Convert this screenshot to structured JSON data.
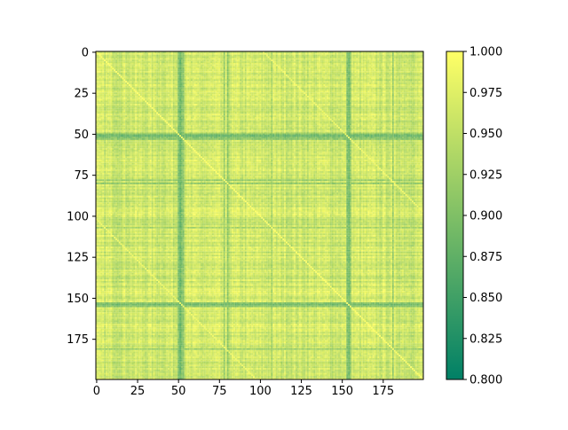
{
  "chart_data": {
    "type": "heatmap",
    "title": "",
    "xlabel": "",
    "ylabel": "",
    "n_rows": 200,
    "n_cols": 200,
    "xlim": [
      0,
      199
    ],
    "ylim": [
      199,
      0
    ],
    "y_axis_inverted": true,
    "x_ticks": [
      0,
      25,
      50,
      75,
      100,
      125,
      150,
      175
    ],
    "x_tick_labels": [
      "0",
      "25",
      "50",
      "75",
      "100",
      "125",
      "150",
      "175"
    ],
    "y_ticks": [
      0,
      25,
      50,
      75,
      100,
      125,
      150,
      175
    ],
    "y_tick_labels": [
      "0",
      "25",
      "50",
      "75",
      "100",
      "125",
      "150",
      "175"
    ],
    "value_range": [
      0.8,
      1.0
    ],
    "typical_value": 0.96,
    "diagonal_value": 1.0,
    "off_diagonal_bands": [
      {
        "offset": 102,
        "value": 0.99
      },
      {
        "offset": -102,
        "value": 0.99
      }
    ],
    "low_similarity_indices": [
      {
        "index": 50,
        "value": 0.9
      },
      {
        "index": 51,
        "value": 0.88
      },
      {
        "index": 52,
        "value": 0.9
      },
      {
        "index": 53,
        "value": 0.91
      },
      {
        "index": 153,
        "value": 0.9
      },
      {
        "index": 154,
        "value": 0.89
      },
      {
        "index": 155,
        "value": 0.91
      },
      {
        "index": 78,
        "value": 0.92
      },
      {
        "index": 80,
        "value": 0.91
      },
      {
        "index": 107,
        "value": 0.93
      },
      {
        "index": 181,
        "value": 0.92
      }
    ],
    "colormap": "summer",
    "colors": {
      "low": "#008066",
      "high": "#ffff66"
    },
    "colorbar": {
      "min": 0.8,
      "max": 1.0,
      "ticks": [
        0.8,
        0.825,
        0.85,
        0.875,
        0.9,
        0.925,
        0.95,
        0.975,
        1.0
      ],
      "tick_labels": [
        "0.800",
        "0.825",
        "0.850",
        "0.875",
        "0.900",
        "0.925",
        "0.950",
        "0.975",
        "1.000"
      ]
    }
  }
}
